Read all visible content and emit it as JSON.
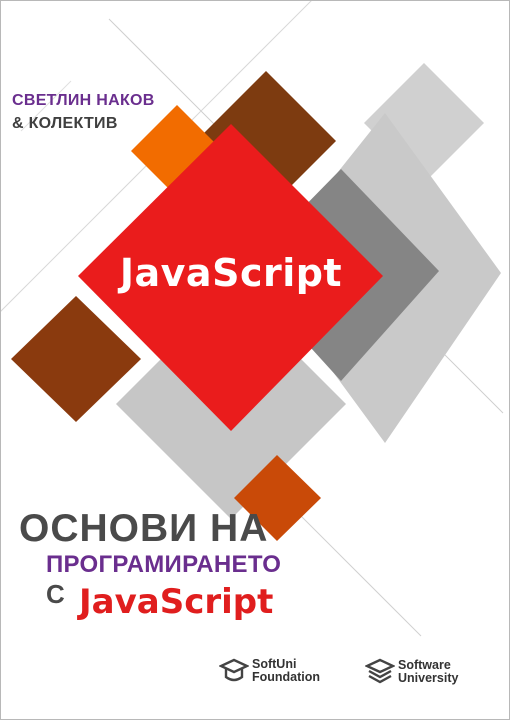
{
  "author": {
    "name": "СВЕТЛИН НАКОВ",
    "coauthors": "& КОЛЕКТИВ"
  },
  "cover_center_word": "JavaScript",
  "title": {
    "line1": "ОСНОВИ НА",
    "line2": "ПРОГРАМИРАНЕТО",
    "line3_prefix": "С",
    "line3_language": "JavaScript"
  },
  "logos": [
    {
      "line1": "SoftUni",
      "line2": "Foundation",
      "icon": "softuni-foundation-logo-icon"
    },
    {
      "line1": "Software",
      "line2": "University",
      "icon": "software-university-logo-icon"
    }
  ],
  "colors": {
    "purple": "#6a2e8e",
    "red": "#e01e1e",
    "orange": "#f26c00",
    "brown": "#7f3a0f",
    "dark_gray": "#8a8a8a",
    "light_gray": "#c8c8c8"
  }
}
